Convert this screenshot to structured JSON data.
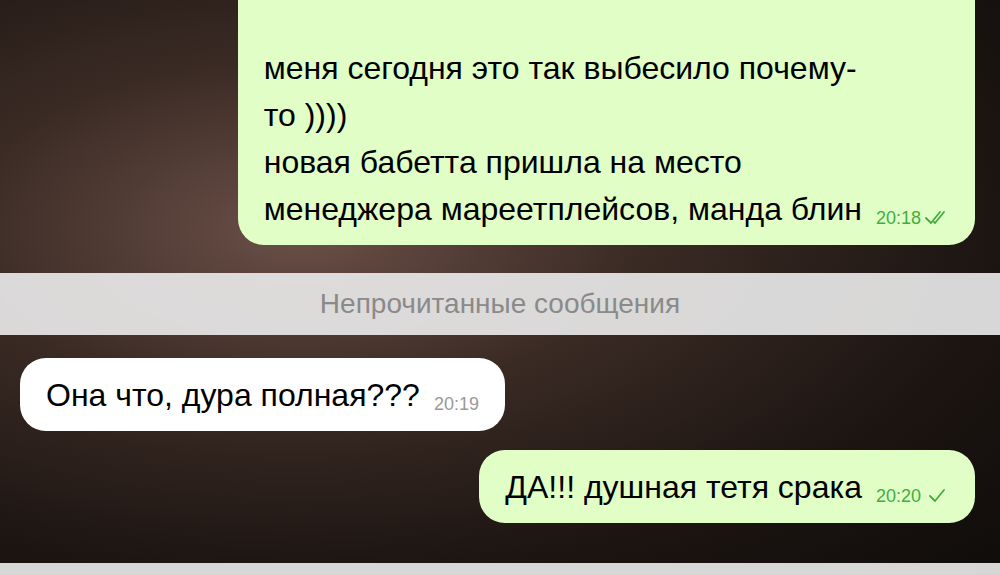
{
  "messages": [
    {
      "direction": "outgoing",
      "lines": [
        "меня сегодня это так выбесило почему-",
        "то ))))",
        "новая бабетта пришла на место",
        "менеджера мареетплейсов, манда блин"
      ],
      "time": "20:18",
      "read": true
    },
    {
      "direction": "outgoing",
      "lines": [
        "ДА!!! душная тетя срака"
      ],
      "time": "20:20",
      "read": false
    }
  ],
  "unread_divider": "Непрочитанные сообщения",
  "incoming": [
    {
      "direction": "incoming",
      "lines": [
        "Она что, дура полная???"
      ],
      "time": "20:19",
      "read": false
    }
  ]
}
